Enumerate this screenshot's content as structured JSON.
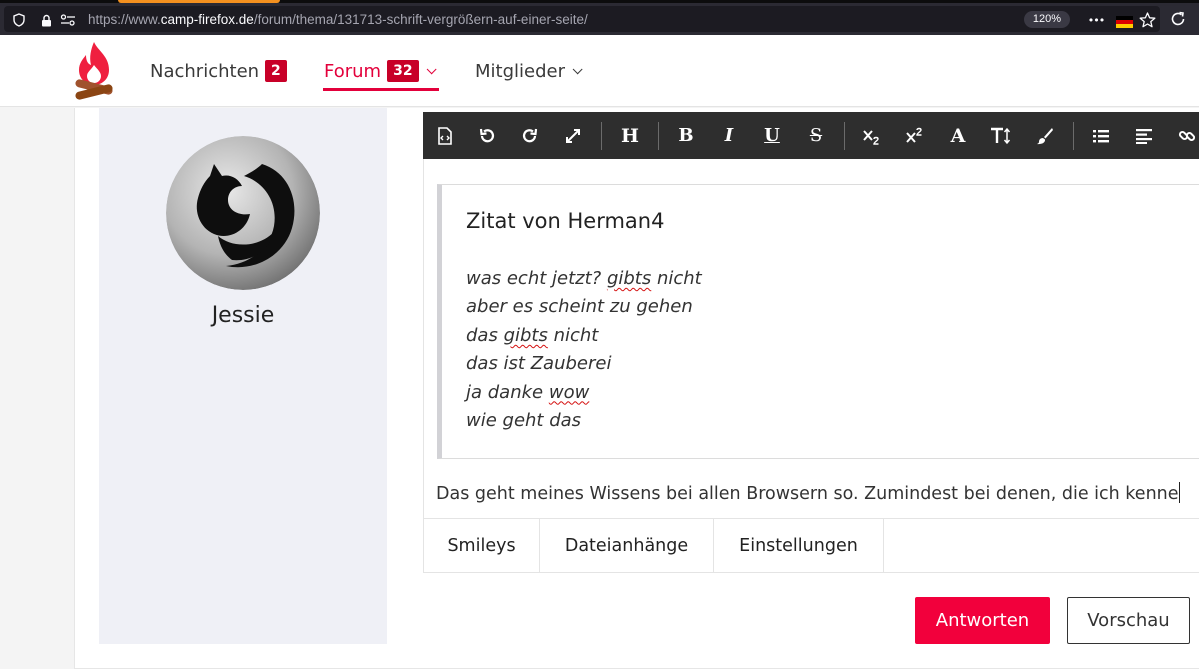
{
  "browser": {
    "url_prefix": "https://www.",
    "url_domain": "camp-firefox.de",
    "url_path": "/forum/thema/131713-schrift-vergrößern-auf-einer-seite/",
    "zoom": "120%",
    "more_glyph": "•••"
  },
  "nav": {
    "messages": {
      "label": "Nachrichten",
      "badge": "2"
    },
    "forum": {
      "label": "Forum",
      "badge": "32"
    },
    "members": {
      "label": "Mitglieder"
    }
  },
  "user": {
    "name": "Jessie"
  },
  "toolbar": {
    "heading": "H",
    "bold": "B",
    "italic": "I",
    "underline": "U",
    "strike": "S",
    "font": "A"
  },
  "quote": {
    "title": "Zitat von Herman4",
    "lines": [
      [
        "was echt jetzt? ",
        "gibts",
        " nicht"
      ],
      [
        "aber es scheint zu gehen",
        "",
        ""
      ],
      [
        "das ",
        "gibts",
        " nicht"
      ],
      [
        "das ist Zauberei",
        "",
        ""
      ],
      [
        "ja danke ",
        "wow",
        ""
      ],
      [
        "wie geht das",
        "",
        ""
      ]
    ]
  },
  "reply": {
    "text": "Das geht meines Wissens bei allen Browsern so. Zumindest bei denen, die ich kenne"
  },
  "tabs": [
    "Smileys",
    "Dateianhänge",
    "Einstellungen"
  ],
  "actions": {
    "submit": "Antworten",
    "preview": "Vorschau"
  },
  "colors": {
    "accent": "#e3003b",
    "badge": "#c80028",
    "toolbar": "#2e2e2e",
    "panel": "#eff0f6"
  }
}
